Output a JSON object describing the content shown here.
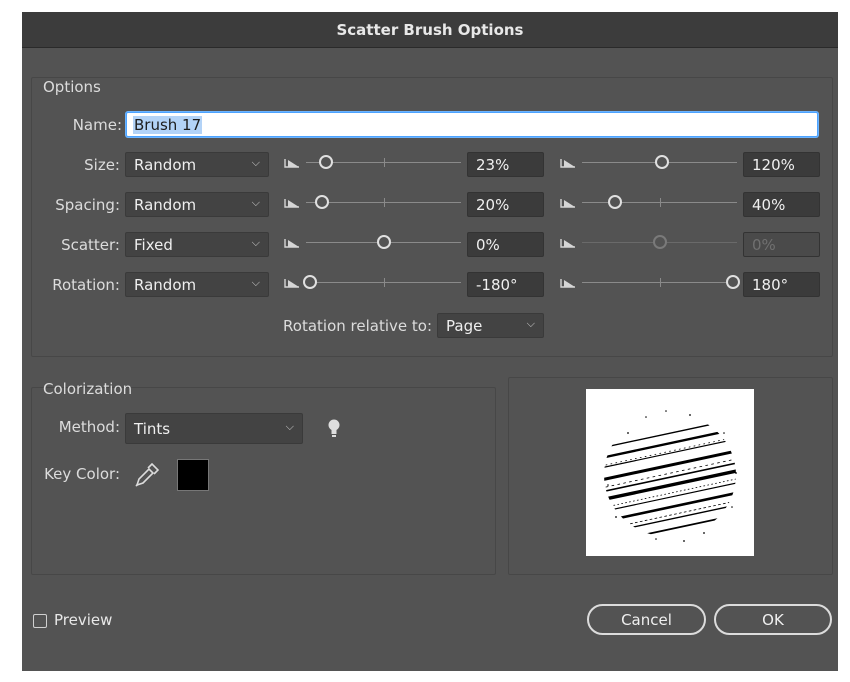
{
  "dialog": {
    "title": "Scatter Brush Options"
  },
  "options": {
    "section_label": "Options",
    "name_label": "Name:",
    "name_value": "Brush 17",
    "rows": [
      {
        "label": "Size:",
        "mode": "Random",
        "min": "23%",
        "max": "120%",
        "min_pos": 0.11,
        "max_pos": 0.52,
        "max_disabled": false
      },
      {
        "label": "Spacing:",
        "mode": "Random",
        "min": "20%",
        "max": "40%",
        "min_pos": 0.08,
        "max_pos": 0.2,
        "max_disabled": false
      },
      {
        "label": "Scatter:",
        "mode": "Fixed",
        "min": "0%",
        "max": "0%",
        "min_pos": 0.5,
        "max_pos": 0.5,
        "max_disabled": true
      },
      {
        "label": "Rotation:",
        "mode": "Random",
        "min": "-180°",
        "max": "180°",
        "min_pos": 0.0,
        "max_pos": 1.0,
        "max_disabled": false
      }
    ],
    "rotation_relative_label": "Rotation relative to:",
    "rotation_relative_value": "Page"
  },
  "colorization": {
    "section_label": "Colorization",
    "method_label": "Method:",
    "method_value": "Tints",
    "key_color_label": "Key Color:",
    "key_color": "#000000",
    "tip_icon": "lightbulb-icon",
    "eyedropper_icon": "eyedropper-icon"
  },
  "footer": {
    "preview_label": "Preview",
    "preview_checked": false,
    "cancel_label": "Cancel",
    "ok_label": "OK"
  },
  "colors": {
    "dialog_bg": "#535353",
    "title_bg": "#3c3c3c",
    "focus": "#4da3ff"
  }
}
